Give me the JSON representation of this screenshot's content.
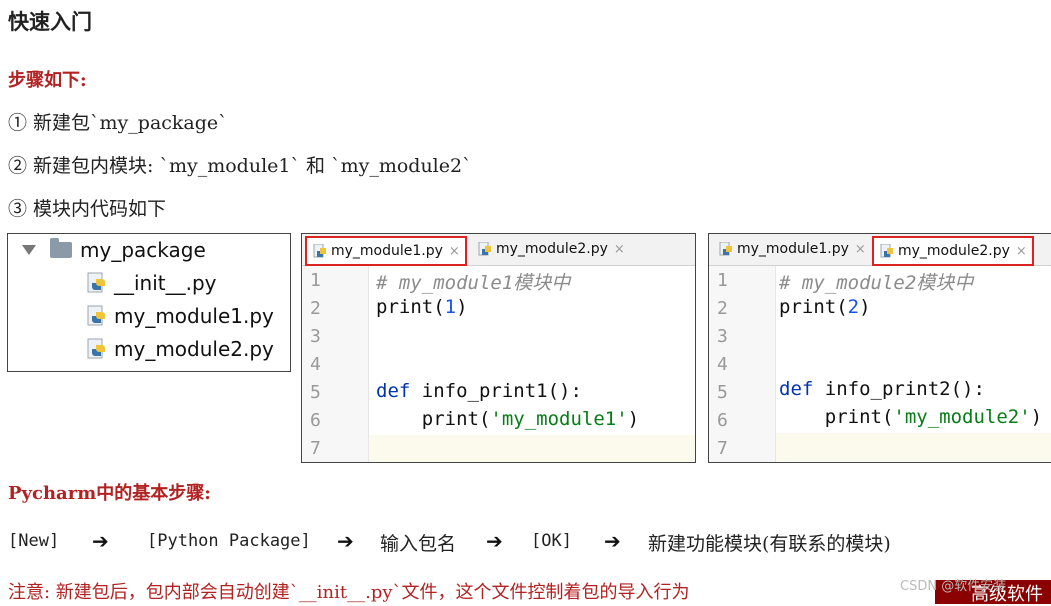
{
  "title": "快速入门",
  "steps_heading": "步骤如下:",
  "steps": [
    "① 新建包`my_package`",
    "② 新建包内模块: `my_module1` 和 `my_module2`",
    "③ 模块内代码如下"
  ],
  "tree": {
    "package": "my_package",
    "files": [
      "__init__.py",
      "my_module1.py",
      "my_module2.py"
    ]
  },
  "editor1": {
    "tabs": [
      "my_module1.py",
      "my_module2.py"
    ],
    "close_glyph": "×",
    "line_numbers": [
      "1",
      "2",
      "3",
      "4",
      "5",
      "6",
      "7"
    ],
    "lines": {
      "l1": "# my_module1模块中",
      "l2_fn": "print(",
      "l2_num": "1",
      "l2_end": ")",
      "l5_kw": "def",
      "l5_rest": " info_print1():",
      "l6_fn": "    print(",
      "l6_str": "'my_module1'",
      "l6_end": ")"
    }
  },
  "editor2": {
    "tabs": [
      "my_module1.py",
      "my_module2.py"
    ],
    "close_glyph": "×",
    "line_numbers": [
      "1",
      "2",
      "3",
      "4",
      "5",
      "6",
      "7"
    ],
    "lines": {
      "l1": "# my_module2模块中",
      "l2_fn": "print(",
      "l2_num": "2",
      "l2_end": ")",
      "l5_kw": "def",
      "l5_rest": " info_print2():",
      "l6_fn": "    print(",
      "l6_str": "'my_module2'",
      "l6_end": ")"
    }
  },
  "pycharm_heading": "Pycharm中的基本步骤:",
  "flow": [
    "[New]",
    "[Python Package]",
    "输入包名",
    "[OK]",
    "新建功能模块(有联系的模块)"
  ],
  "arrow_glyph": "➔",
  "note": "注意: 新建包后，包内部会自动创建`__init__.py`文件，这个文件控制着包的导入行为",
  "watermark": "CSDN @软件安装",
  "corner_text": "高级软件",
  "colors": {
    "accent_red": "#b22222",
    "tab_highlight": "#dd2222"
  }
}
